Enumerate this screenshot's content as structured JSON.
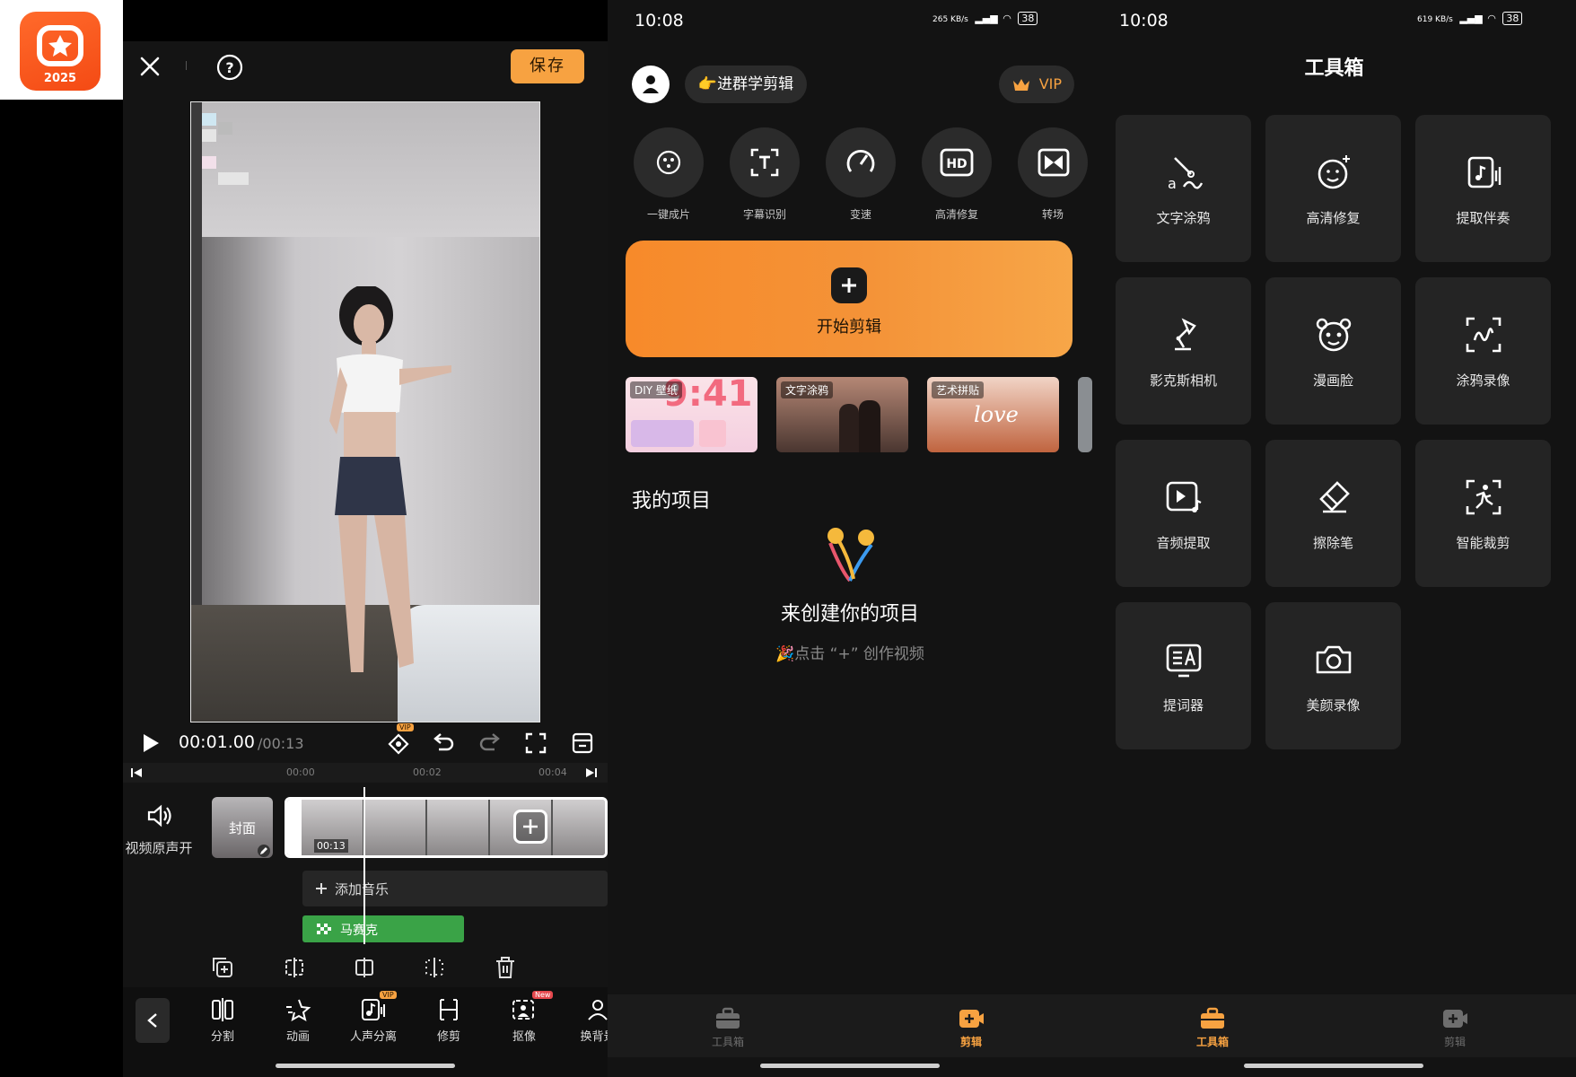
{
  "app_logo": {
    "year": "2025"
  },
  "editor": {
    "save_label": "保存",
    "time_current": "00:01.00",
    "time_total": "/00:13",
    "ruler_ticks": [
      "00:00",
      "00:02",
      "00:04"
    ],
    "audio_label": "视频原声开",
    "cover_label": "封面",
    "clip_duration": "00:13",
    "add_music_label": "添加音乐",
    "mosaic_track_label": "马赛克",
    "tools": [
      {
        "label": "分割",
        "icon": "split-icon",
        "badge": ""
      },
      {
        "label": "动画",
        "icon": "animation-icon",
        "badge": ""
      },
      {
        "label": "人声分离",
        "icon": "vocal-separate-icon",
        "badge": "VIP"
      },
      {
        "label": "修剪",
        "icon": "trim-icon",
        "badge": ""
      },
      {
        "label": "抠像",
        "icon": "cutout-icon",
        "badge": "New"
      },
      {
        "label": "换背景",
        "icon": "change-bg-icon",
        "badge": ""
      }
    ],
    "vip_badge": "VIP"
  },
  "home": {
    "status_time": "10:08",
    "status_speed": "265 KB/s",
    "battery": "38",
    "group_chip": "👉进群学剪辑",
    "vip_label": "VIP",
    "quick_tools": [
      {
        "label": "一键成片",
        "icon": "one-click-film-icon"
      },
      {
        "label": "字幕识别",
        "icon": "subtitle-recognize-icon"
      },
      {
        "label": "变速",
        "icon": "speed-icon"
      },
      {
        "label": "高清修复",
        "icon": "hd-repair-icon"
      },
      {
        "label": "转场",
        "icon": "transition-icon"
      }
    ],
    "hd_badge": "HD",
    "start_label": "开始剪辑",
    "templates": [
      {
        "tag": "DIY 壁纸",
        "number": "9:41"
      },
      {
        "tag": "文字涂鸦"
      },
      {
        "tag": "艺术拼贴",
        "word": "love"
      }
    ],
    "my_projects": "我的项目",
    "empty_title": "来创建你的项目",
    "empty_hint": "🎉点击 “+” 创作视频",
    "nav": [
      {
        "label": "工具箱",
        "active": false
      },
      {
        "label": "剪辑",
        "active": true
      }
    ]
  },
  "toolbox": {
    "status_time": "10:08",
    "status_speed": "619 KB/s",
    "battery": "38",
    "title": "工具箱",
    "items": [
      {
        "label": "文字涂鸦",
        "icon": "text-doodle-icon"
      },
      {
        "label": "高清修复",
        "icon": "hd-face-repair-icon"
      },
      {
        "label": "提取伴奏",
        "icon": "extract-accompaniment-icon"
      },
      {
        "label": "影克斯相机",
        "icon": "lamp-camera-icon"
      },
      {
        "label": "漫画脸",
        "icon": "comic-face-icon"
      },
      {
        "label": "涂鸦录像",
        "icon": "doodle-record-icon"
      },
      {
        "label": "音频提取",
        "icon": "audio-extract-icon"
      },
      {
        "label": "擦除笔",
        "icon": "eraser-icon"
      },
      {
        "label": "智能裁剪",
        "icon": "smart-crop-icon"
      },
      {
        "label": "提词器",
        "icon": "teleprompter-icon"
      },
      {
        "label": "美颜录像",
        "icon": "beauty-camera-icon"
      }
    ],
    "nav": [
      {
        "label": "工具箱",
        "active": true
      },
      {
        "label": "剪辑",
        "active": false
      }
    ]
  },
  "colors": {
    "accent": "#f7a241",
    "clip_green": "#3aa347",
    "dark_bg": "#131313",
    "card_bg": "#242424"
  }
}
